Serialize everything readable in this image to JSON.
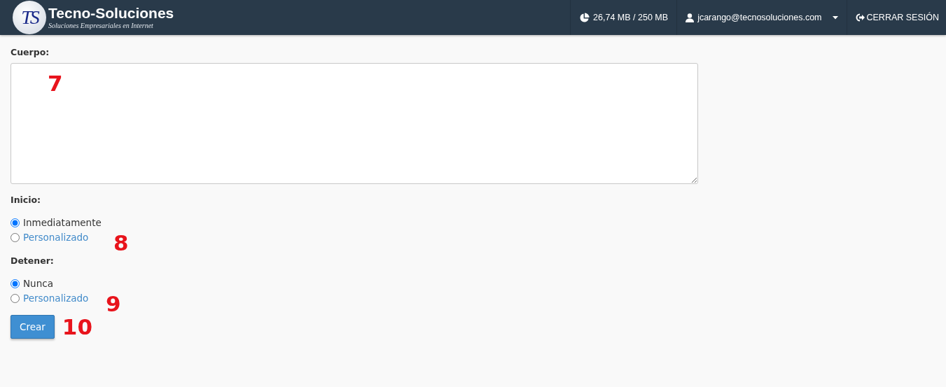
{
  "header": {
    "logo_mark": "TS",
    "brand": "Tecno-Soluciones",
    "tagline": "Soluciones Empresariales en Internet",
    "disk_usage": "26,74 MB / 250 MB",
    "user": "jcarango@tecnosoluciones.com",
    "logout": "CERRAR SESIÓN"
  },
  "body_field": {
    "label": "Cuerpo:",
    "annotation": "7"
  },
  "groups": [
    {
      "label": "Inicio:",
      "annotation": "8",
      "options": [
        {
          "label": "Inmediatamente",
          "selected": true
        },
        {
          "label": "Personalizado",
          "selected": false
        }
      ]
    },
    {
      "label": "Detener:",
      "annotation": "9",
      "options": [
        {
          "label": "Nunca",
          "selected": true
        },
        {
          "label": "Personalizado",
          "selected": false
        }
      ]
    }
  ],
  "submit": {
    "label": "Crear",
    "annotation": "10"
  }
}
